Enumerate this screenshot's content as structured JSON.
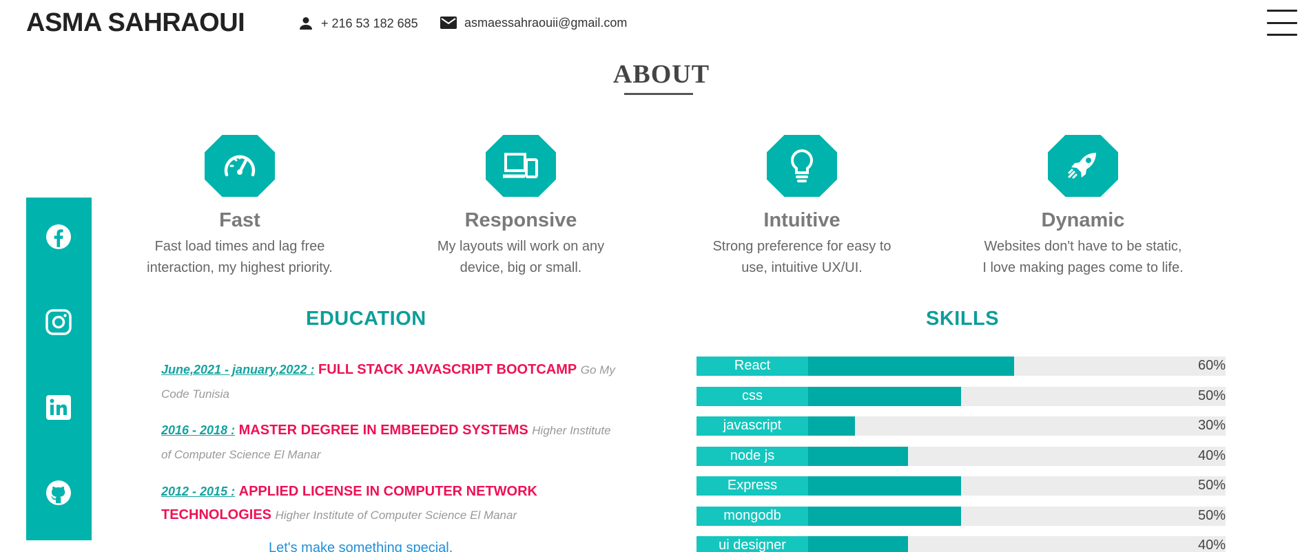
{
  "header": {
    "name": "ASMA SAHRAOUI",
    "phone": "+ 216 53 182 685",
    "email": "asmaessahraouii@gmail.com"
  },
  "about": {
    "title": "ABOUT"
  },
  "social": [
    "facebook-icon",
    "instagram-icon",
    "linkedin-icon",
    "github-icon"
  ],
  "features": [
    {
      "icon": "speedometer-icon",
      "title": "Fast",
      "line1": "Fast load times and lag free",
      "line2": "interaction, my highest priority."
    },
    {
      "icon": "devices-icon",
      "title": "Responsive",
      "line1": "My layouts will work on any",
      "line2": "device, big or small."
    },
    {
      "icon": "lightbulb-icon",
      "title": "Intuitive",
      "line1": "Strong preference for easy to",
      "line2": "use, intuitive UX/UI."
    },
    {
      "icon": "rocket-icon",
      "title": "Dynamic",
      "line1": "Websites don't have to be static,",
      "line2": "I love making pages come to life."
    }
  ],
  "education": {
    "title": "EDUCATION",
    "items": [
      {
        "date": "June,2021 - january,2022 :",
        "degree": "FULL STACK JAVASCRIPT BOOTCAMP",
        "school": "Go My Code Tunisia"
      },
      {
        "date": "2016 - 2018 :",
        "degree": "MASTER DEGREE IN EMBEEDED SYSTEMS",
        "school": "Higher Institute of Computer Science El Manar"
      },
      {
        "date": "2012 - 2015 :",
        "degree": "APPLIED LICENSE IN COMPUTER NETWORK TECHNOLOGIES",
        "school": "Higher Institute of Computer Science El Manar"
      }
    ],
    "cta": "Let's make something special."
  },
  "skills": {
    "title": "SKILLS",
    "items": [
      {
        "name": "React",
        "percent": 60,
        "label": "60%"
      },
      {
        "name": "css",
        "percent": 50,
        "label": "50%"
      },
      {
        "name": "javascript",
        "percent": 30,
        "label": "30%"
      },
      {
        "name": "node js",
        "percent": 40,
        "label": "40%"
      },
      {
        "name": "Express",
        "percent": 50,
        "label": "50%"
      },
      {
        "name": "mongodb",
        "percent": 50,
        "label": "50%"
      },
      {
        "name": "ui designer",
        "percent": 40,
        "label": "40%"
      }
    ]
  },
  "colors": {
    "accent": "#00b3ad",
    "degree": "#ee1155",
    "heading": "#0d9e9b"
  }
}
